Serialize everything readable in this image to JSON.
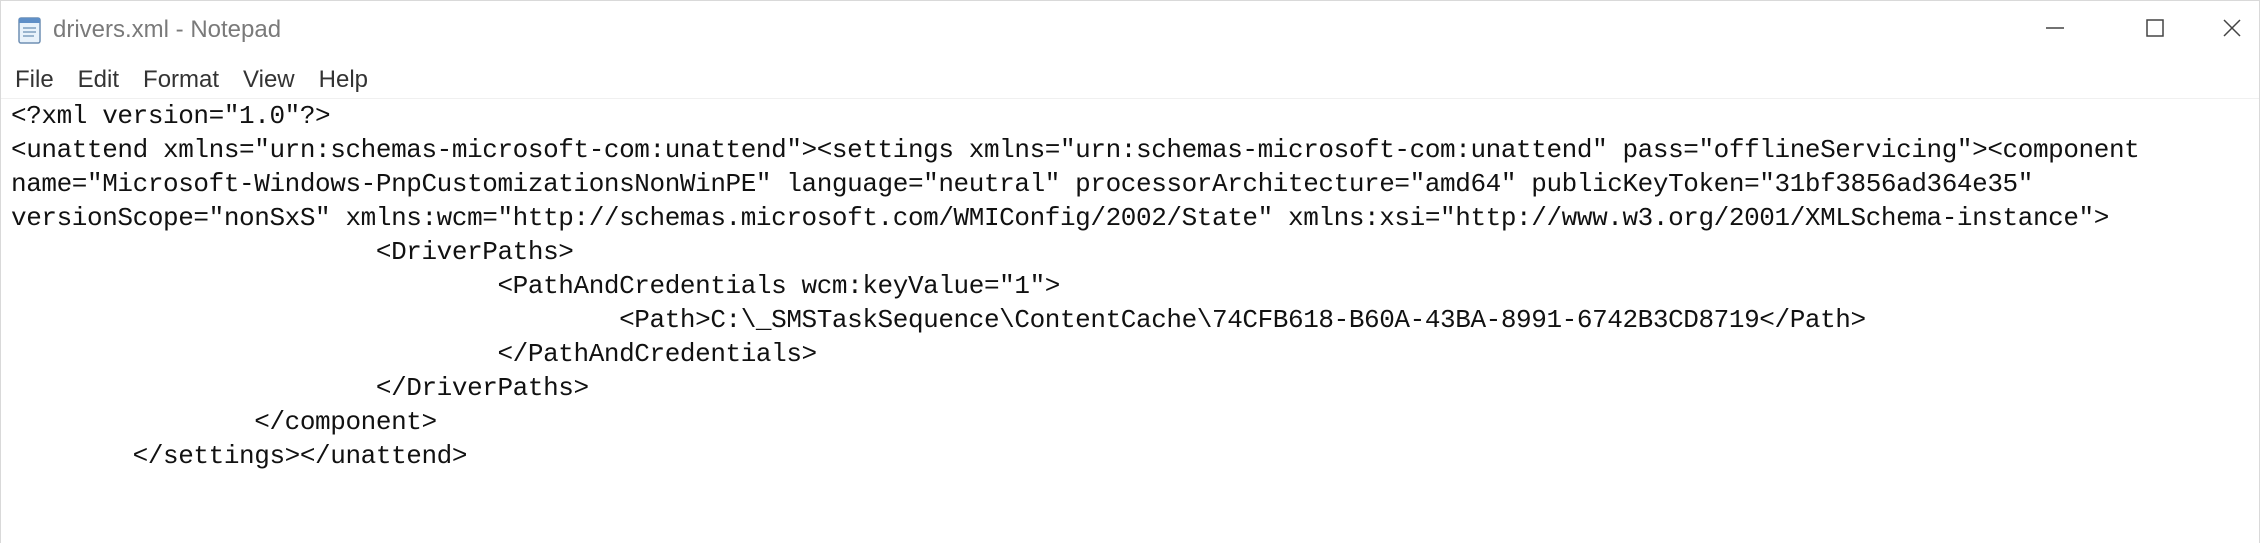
{
  "window": {
    "title": "drivers.xml - Notepad"
  },
  "menu": {
    "file": "File",
    "edit": "Edit",
    "format": "Format",
    "view": "View",
    "help": "Help"
  },
  "editor": {
    "lines": [
      "<?xml version=\"1.0\"?>",
      "<unattend xmlns=\"urn:schemas-microsoft-com:unattend\"><settings xmlns=\"urn:schemas-microsoft-com:unattend\" pass=\"offlineServicing\"><component",
      "name=\"Microsoft-Windows-PnpCustomizationsNonWinPE\" language=\"neutral\" processorArchitecture=\"amd64\" publicKeyToken=\"31bf3856ad364e35\"",
      "versionScope=\"nonSxS\" xmlns:wcm=\"http://schemas.microsoft.com/WMIConfig/2002/State\" xmlns:xsi=\"http://www.w3.org/2001/XMLSchema-instance\">",
      "                        <DriverPaths>",
      "                                <PathAndCredentials wcm:keyValue=\"1\">",
      "                                        <Path>C:\\_SMSTaskSequence\\ContentCache\\74CFB618-B60A-43BA-8991-6742B3CD8719</Path>",
      "                                </PathAndCredentials>",
      "                        </DriverPaths>",
      "                </component>",
      "        </settings></unattend>"
    ]
  },
  "icons": {
    "app": "notepad-icon",
    "minimize": "minimize-icon",
    "maximize": "maximize-icon",
    "close": "close-icon"
  }
}
